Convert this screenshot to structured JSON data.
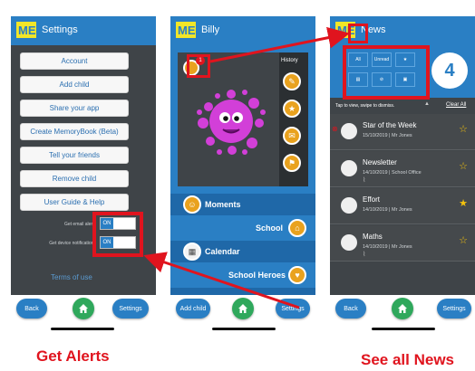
{
  "settings_screen": {
    "title": "Settings",
    "buttons": [
      "Account",
      "Add child",
      "Share your app",
      "Create MemoryBook (Beta)",
      "Tell your friends",
      "Remove child",
      "User Guide & Help"
    ],
    "email_alerts_label": "Get email alerts",
    "device_notifications_label": "Get device notifications",
    "toggle_on": "ON",
    "terms": "Terms of use",
    "nav_back": "Back",
    "nav_settings": "Settings"
  },
  "child_screen": {
    "title": "Billy",
    "history": "History",
    "badge": "1",
    "menu": [
      "Moments",
      "School",
      "Calendar",
      "School Heroes"
    ],
    "nav_add_child": "Add child",
    "nav_settings": "Settings"
  },
  "news_screen": {
    "title": "News",
    "filters": [
      "All",
      "Unread",
      "★"
    ],
    "count": "4",
    "hint": "Tap to view, swipe to dismiss.",
    "clear_all": "Clear All",
    "items": [
      {
        "title": "Star of the Week",
        "meta": "15/10/2019 | Mr Jones",
        "starred": false
      },
      {
        "title": "Newsletter",
        "meta": "14/10/2019 | School Office",
        "starred": false
      },
      {
        "title": "Effort",
        "meta": "14/10/2019 | Mr Jones",
        "starred": true
      },
      {
        "title": "Maths",
        "meta": "14/10/2019 | Mr Jones",
        "starred": false
      }
    ],
    "nav_back": "Back",
    "nav_settings": "Settings"
  },
  "captions": {
    "left": "Get Alerts",
    "right": "See all News"
  },
  "colors": {
    "accent_blue": "#2a7fc4",
    "alert_red": "#e0141e",
    "home_green": "#2fa85c",
    "star_yellow": "#f4c20d"
  }
}
